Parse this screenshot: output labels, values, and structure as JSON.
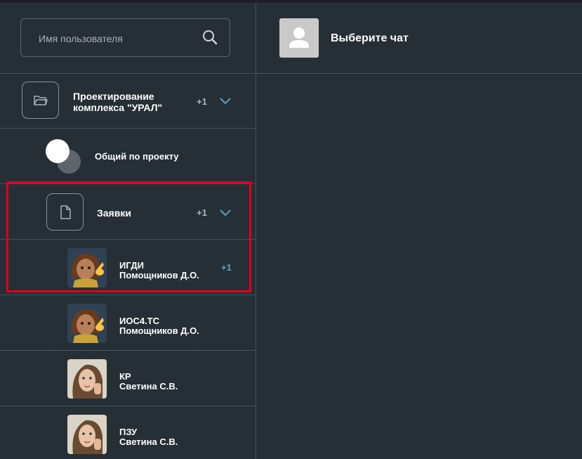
{
  "search": {
    "placeholder": "Имя пользователя"
  },
  "header": {
    "title": "Выберите чат"
  },
  "project": {
    "title_line1": "Проектирование",
    "title_line2": "комплекса \"УРАЛ\"",
    "badge": "+1"
  },
  "general": {
    "title": "Общий по проекту"
  },
  "zayavki": {
    "title": "Заявки",
    "badge": "+1"
  },
  "chats": [
    {
      "name": "ИГДИ",
      "person": "Помощников Д.О.",
      "badge": "+1"
    },
    {
      "name": "ИОС4.ТС",
      "person": "Помощников Д.О.",
      "badge": ""
    },
    {
      "name": "КР",
      "person": "Светина С.В.",
      "badge": ""
    },
    {
      "name": "ПЗУ",
      "person": "Светина С.В.",
      "badge": ""
    }
  ],
  "colors": {
    "accent": "#5aa3c7",
    "highlight": "#e3001b",
    "background": "#262e36"
  }
}
